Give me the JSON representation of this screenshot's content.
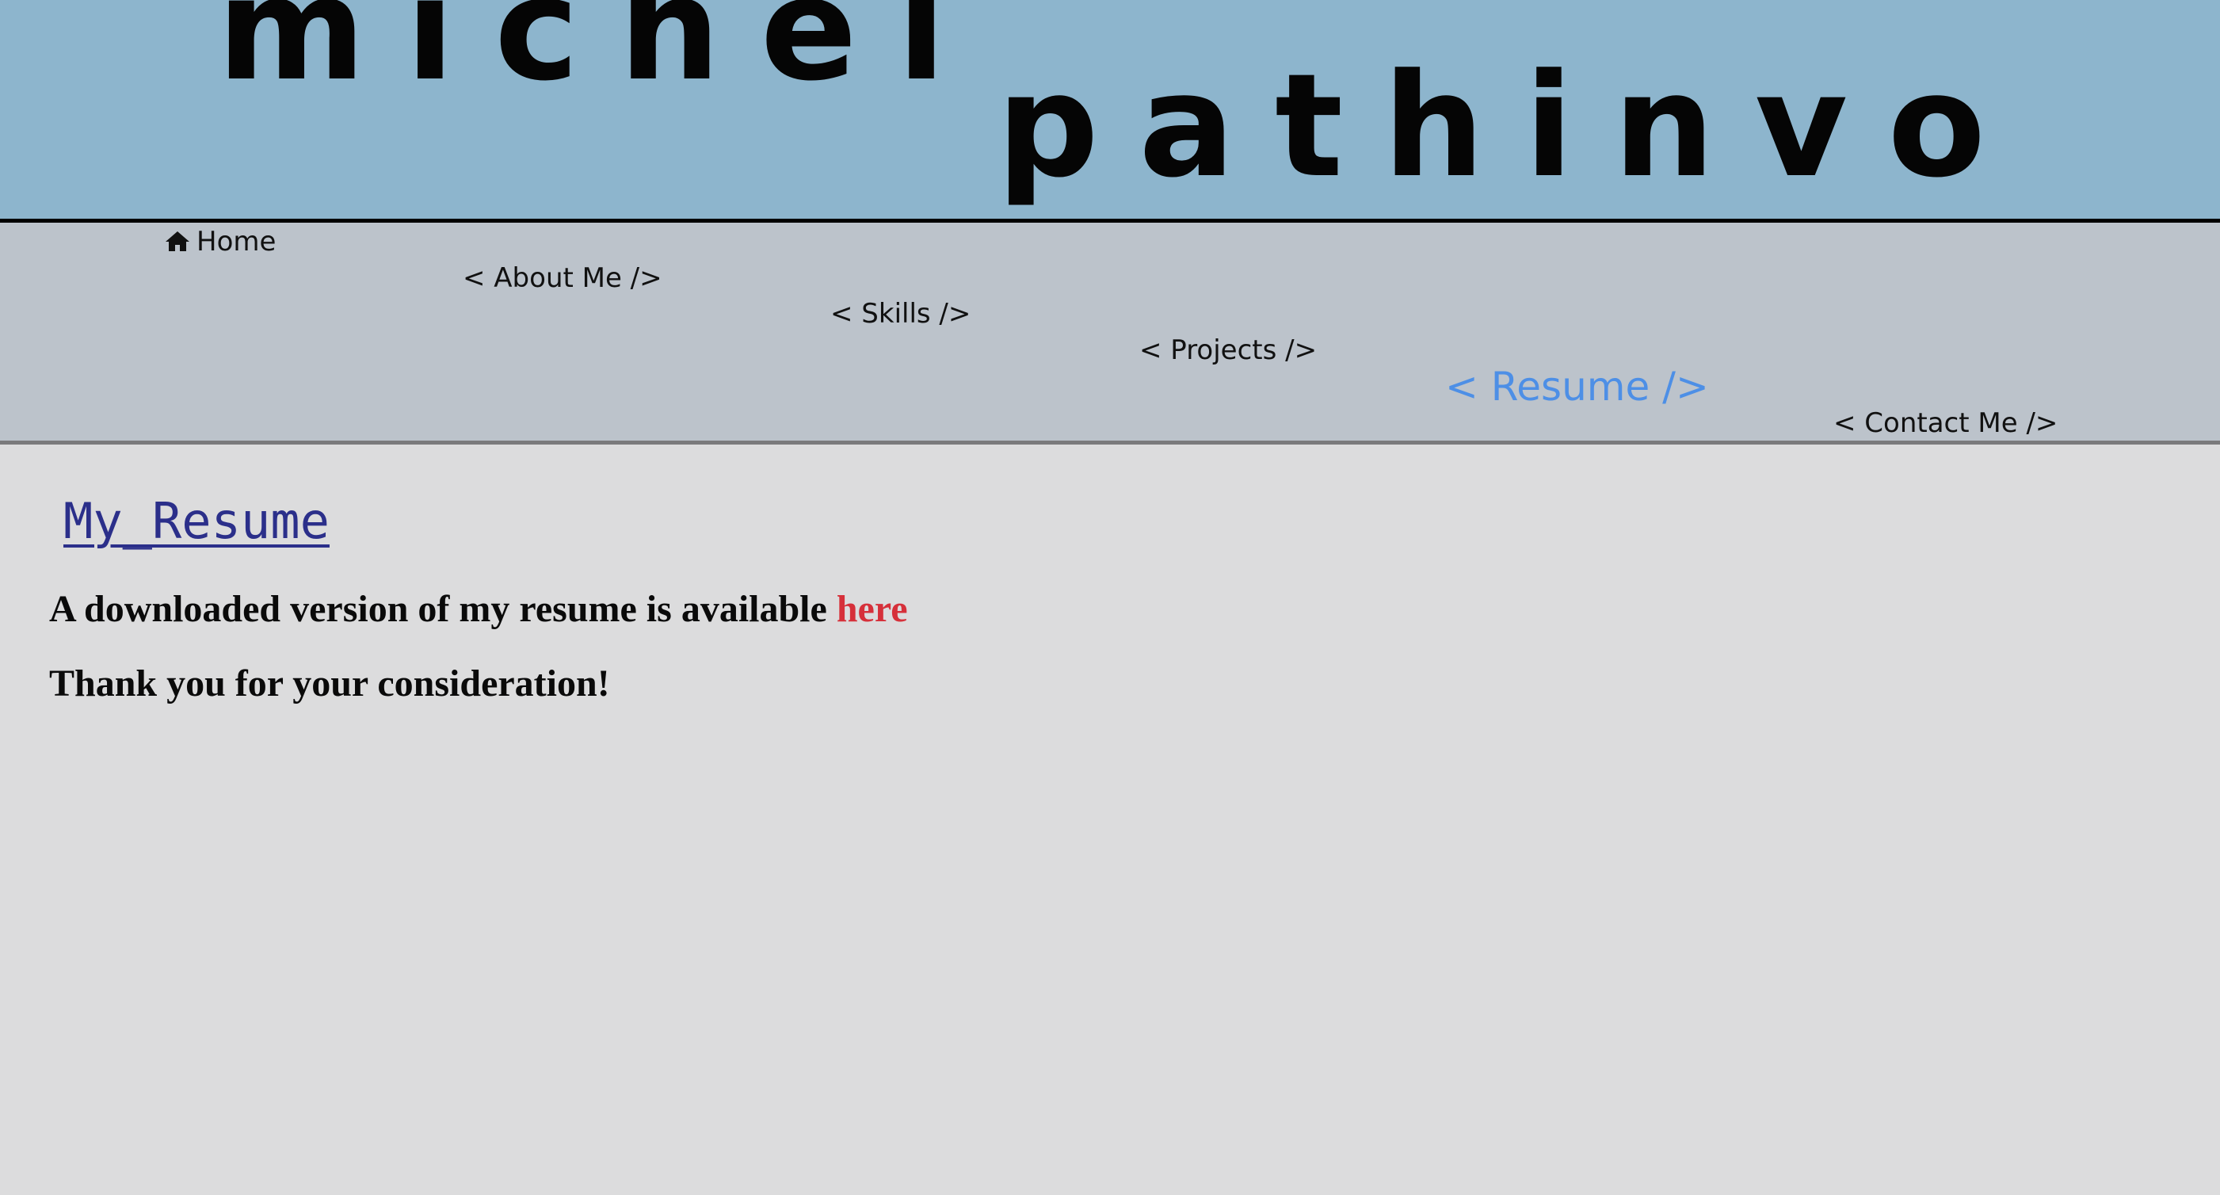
{
  "header": {
    "first_name": "michel",
    "last_name": "pathinvo"
  },
  "nav": {
    "items": [
      {
        "label": "Home",
        "icon": "home-icon"
      },
      {
        "label": "< About Me />"
      },
      {
        "label": "< Skills />"
      },
      {
        "label": "< Projects />"
      },
      {
        "label": "< Resume />",
        "active": true
      },
      {
        "label": "< Contact Me />"
      }
    ]
  },
  "main": {
    "title": "My_Resume",
    "download_text": "A downloaded version of my resume is available ",
    "download_link": "here",
    "thanks_text": "Thank you for your consideration!"
  },
  "colors": {
    "header_bg": "#8db5cd",
    "nav_bg": "#bcc3cb",
    "page_bg": "#dcdcdd",
    "active_nav": "#4d8fe6",
    "title": "#2b2f8a",
    "link": "#d6303a"
  }
}
